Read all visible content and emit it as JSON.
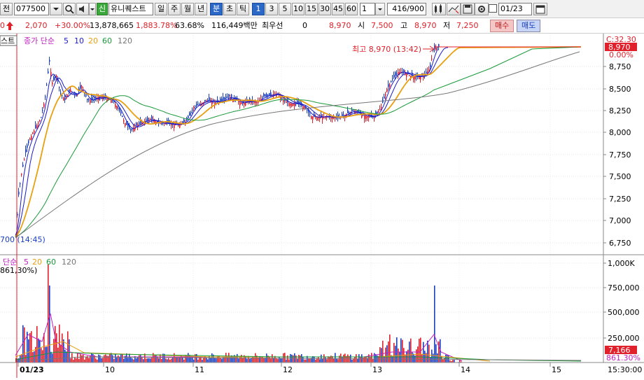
{
  "toolbar": {
    "prefix_label": "전",
    "code": "077500",
    "badge": "신",
    "name": "유니퀘스트",
    "periods": [
      "일",
      "주",
      "월",
      "년",
      "분",
      "초",
      "틱"
    ],
    "active_period": "분",
    "intervals": [
      "1",
      "3",
      "5",
      "10",
      "15",
      "30",
      "45",
      "60"
    ],
    "active_interval": "1",
    "unit_value": "1",
    "count": "416",
    "count_total": "/900",
    "date": "01/23"
  },
  "quote": {
    "change_prefix": "0",
    "change": "2,070",
    "change_pct": "+30.00%",
    "volume": "13,878,665",
    "volume_ratio": "1,883.78%",
    "turnover_ratio": "63.68%",
    "amount": "116,449백만",
    "priority_label": "최우선",
    "priority_value": "0",
    "price": "8,970",
    "open_label": "시",
    "open": "7,500",
    "high_label": "고",
    "high": "8,970",
    "low_label": "저",
    "low": "7,250",
    "buy_label": "매수",
    "sell_label": "매도"
  },
  "price_panel": {
    "legend_prefix": "스트",
    "legend_text": "종가 단순",
    "ma": [
      {
        "period": "5",
        "color": "#1a1ac8"
      },
      {
        "period": "10",
        "color": "#1a1ac8"
      },
      {
        "period": "20",
        "color": "#e8a010"
      },
      {
        "period": "60",
        "color": "#1a9a3a"
      },
      {
        "period": "120",
        "color": "#777777"
      }
    ],
    "high_annotation": "최고 8,970 (13:42)",
    "low_annotation": "700 (14:45)",
    "y_ticks": [
      "8,750",
      "8,500",
      "8,250",
      "8,000",
      "7,750",
      "7,500",
      "7,250",
      "7,000",
      "6,750"
    ],
    "top_label": "C:32.30",
    "current_price_tag": "8,970",
    "pct_label": "0.00%",
    "colors": {
      "up": "#e0202a",
      "down": "#1a3fc0",
      "current": "#e0202a"
    }
  },
  "volume_panel": {
    "legend_text": "단순",
    "ma": [
      {
        "period": "5",
        "color": "#c020c0"
      },
      {
        "period": "20",
        "color": "#e8a010"
      },
      {
        "period": "60",
        "color": "#1a9a3a"
      },
      {
        "period": "120",
        "color": "#777777"
      }
    ],
    "left_label": "861,30%)",
    "y_ticks": [
      "1,000K",
      "750,000",
      "500,000",
      "250,000"
    ],
    "current_volume_tag": "7,166",
    "current_pct_tag": "861.30%"
  },
  "x_axis": {
    "labels": [
      "01/23",
      "10",
      "11",
      "12",
      "13",
      "14",
      "15"
    ],
    "time_label": "15:30:00"
  }
}
